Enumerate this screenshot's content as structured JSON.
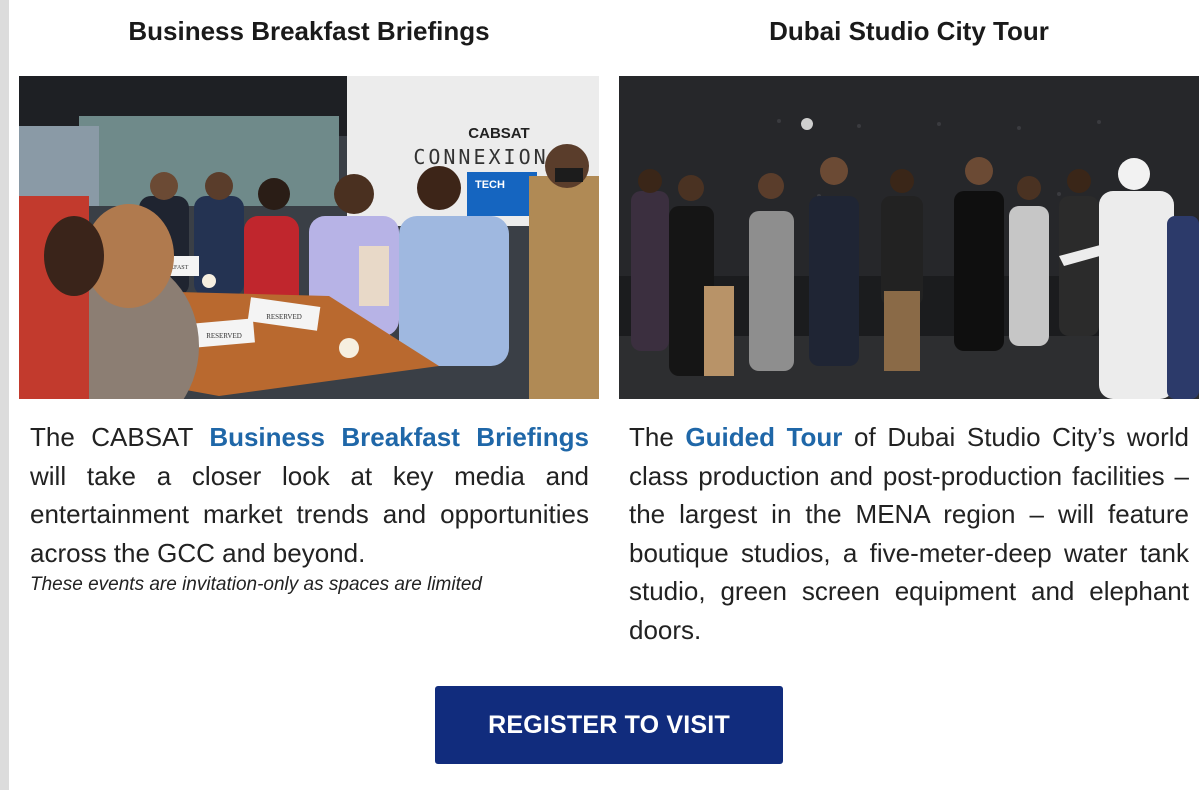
{
  "left": {
    "title": "Business Breakfast Briefings",
    "photo": {
      "sign_brand": "CABSAT",
      "sign_text": "CONNEXION",
      "sign_sub": "TECH",
      "table_cards": [
        "BREAKFAST",
        "RESERVED",
        "RESERVED"
      ]
    },
    "text_prefix": "The CABSAT ",
    "link_text": "Business Breakfast Briefings",
    "text_suffix": " will take a closer look at key media and entertainment market trends and opportunities across the GCC and beyond.",
    "note": "These events are invitation-only as spaces are limited"
  },
  "right": {
    "title": "Dubai Studio City Tour",
    "text_prefix": "The ",
    "link_text": "Guided Tour",
    "text_suffix": " of Dubai Studio City’s world class production and post-production facilities – the largest in the MENA region – will feature boutique studios, a five-meter-deep water tank studio, green screen equipment and elephant doors."
  },
  "cta": {
    "label": "REGISTER TO VISIT"
  },
  "colors": {
    "link": "#1f67a8",
    "button": "#112c7d",
    "rail": "#dcdcdc"
  }
}
